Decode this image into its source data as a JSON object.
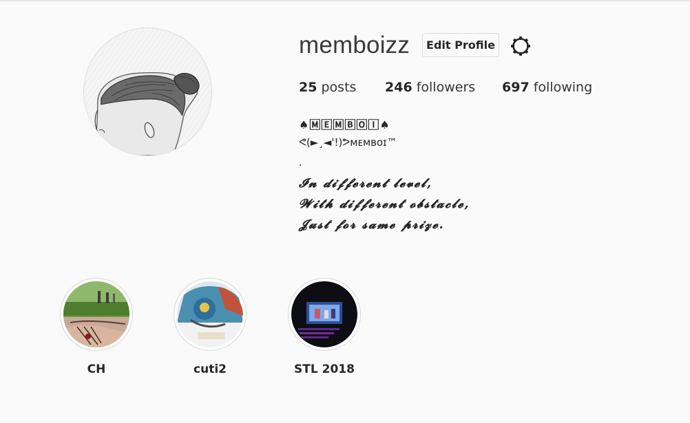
{
  "profile": {
    "username": "memboizz",
    "edit_button_label": "Edit Profile",
    "settings_icon": "gear-icon",
    "avatar_icon": "profile-photo"
  },
  "stats": {
    "posts": {
      "count": "25",
      "label": "posts"
    },
    "followers": {
      "count": "246",
      "label": "followers"
    },
    "following": {
      "count": "697",
      "label": "following"
    }
  },
  "bio": {
    "name_line": "♠🄼🄴🄼🄱🄾🄸♠",
    "tag_line": "ᕙ(►¸◄'!)ᕗᴍᴇᴍʙᴏɪ™",
    "separator": ".",
    "lines": [
      "𝓘𝓷 𝓭𝓲𝓯𝓯𝓮𝓻𝓮𝓷𝓽 𝓵𝓮𝓿𝓮𝓵,",
      "𝓦𝓲𝓽𝓱 𝓭𝓲𝓯𝓯𝓮𝓻𝓮𝓷𝓽 𝓸𝓫𝓼𝓽𝓪𝓬𝓵𝓮,",
      "𝓙𝓾𝓼𝓽 𝓯𝓸𝓻 𝓼𝓪𝓶𝓮 𝓹𝓻𝓲𝔃𝓮."
    ]
  },
  "highlights": [
    {
      "label": "CH"
    },
    {
      "label": "cuti2"
    },
    {
      "label": "STL 2018"
    }
  ],
  "colors": {
    "background": "#fafafa",
    "text": "#262626",
    "border": "#dbdbdb"
  }
}
